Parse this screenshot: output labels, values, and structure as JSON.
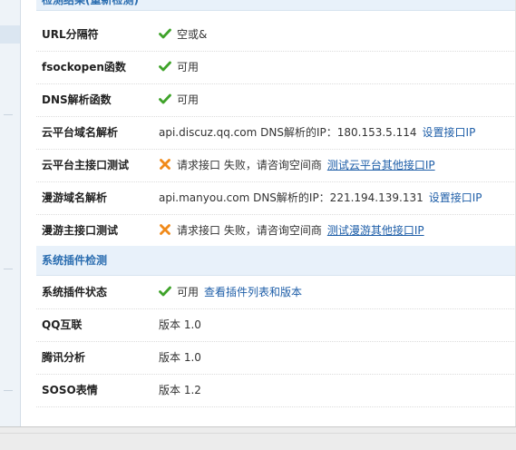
{
  "header_top": "检测结果(重新检测)",
  "rows_top": [
    {
      "label": "URL分隔符",
      "status": "ok",
      "text": "空或&",
      "link": "",
      "link2": ""
    },
    {
      "label": "fsockopen函数",
      "status": "ok",
      "text": "可用",
      "link": "",
      "link2": ""
    },
    {
      "label": "DNS解析函数",
      "status": "ok",
      "text": "可用",
      "link": "",
      "link2": ""
    },
    {
      "label": "云平台域名解析",
      "status": "none",
      "text": "api.discuz.qq.com DNS解析的IP：180.153.5.114",
      "link": "设置接口IP",
      "link2": ""
    },
    {
      "label": "云平台主接口测试",
      "status": "fail",
      "text": "请求接口 失败，请咨询空间商",
      "link": "测试云平台其他接口IP",
      "link2": ""
    },
    {
      "label": "漫游域名解析",
      "status": "none",
      "text": "api.manyou.com DNS解析的IP：221.194.139.131",
      "link": "设置接口IP",
      "link2": ""
    },
    {
      "label": "漫游主接口测试",
      "status": "fail",
      "text": "请求接口 失败，请咨询空间商",
      "link": "测试漫游其他接口IP",
      "link2": ""
    }
  ],
  "header_plugins": "系统插件检测",
  "rows_plugins": [
    {
      "label": "系统插件状态",
      "status": "ok",
      "text": "可用",
      "link": "查看插件列表和版本"
    },
    {
      "label": "QQ互联",
      "status": "none",
      "text": "版本 1.0",
      "link": ""
    },
    {
      "label": "腾讯分析",
      "status": "none",
      "text": "版本 1.0",
      "link": ""
    },
    {
      "label": "SOSO表情",
      "status": "none",
      "text": "版本 1.2",
      "link": ""
    }
  ]
}
